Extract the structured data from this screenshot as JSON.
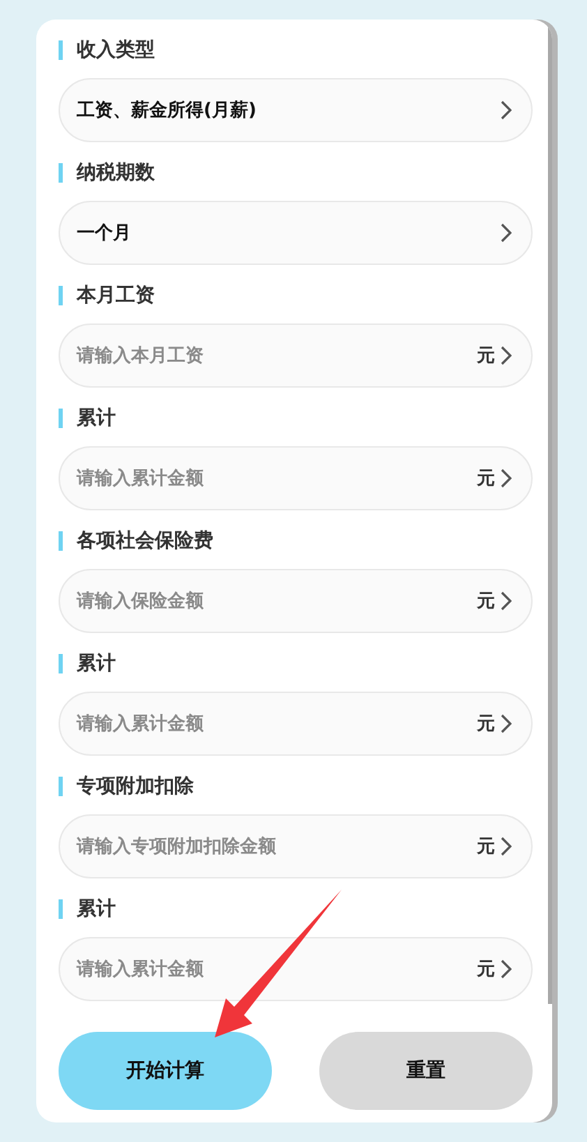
{
  "sections": [
    {
      "label": "收入类型",
      "field": {
        "kind": "select",
        "value": "工资、薪金所得(月薪)"
      }
    },
    {
      "label": "纳税期数",
      "field": {
        "kind": "select",
        "value": "一个月"
      }
    },
    {
      "label": "本月工资",
      "field": {
        "kind": "input",
        "placeholder": "请输入本月工资",
        "unit": "元"
      }
    },
    {
      "label": "累计",
      "field": {
        "kind": "input",
        "placeholder": "请输入累计金额",
        "unit": "元"
      }
    },
    {
      "label": "各项社会保险费",
      "field": {
        "kind": "input",
        "placeholder": "请输入保险金额",
        "unit": "元"
      }
    },
    {
      "label": "累计",
      "field": {
        "kind": "input",
        "placeholder": "请输入累计金额",
        "unit": "元"
      }
    },
    {
      "label": "专项附加扣除",
      "field": {
        "kind": "input",
        "placeholder": "请输入专项附加扣除金额",
        "unit": "元"
      }
    },
    {
      "label": "累计",
      "field": {
        "kind": "input",
        "placeholder": "请输入累计金额",
        "unit": "元"
      }
    }
  ],
  "buttons": [
    {
      "label": "开始计算",
      "kind": "primary"
    },
    {
      "label": "重置",
      "kind": "secondary"
    }
  ]
}
